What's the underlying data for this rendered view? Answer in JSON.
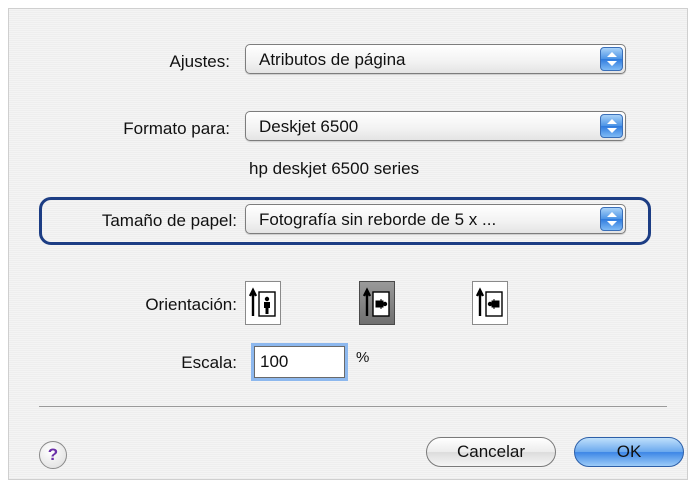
{
  "settings": {
    "label": "Ajustes:",
    "value": "Atributos de página"
  },
  "format_for": {
    "label": "Formato para:",
    "value": "Deskjet 6500",
    "subtitle": "hp deskjet 6500 series"
  },
  "paper_size": {
    "label": "Tamaño de papel:",
    "value": "Fotografía sin reborde de 5 x ..."
  },
  "orientation": {
    "label": "Orientación:",
    "options": [
      "portrait",
      "landscape",
      "reverse-landscape"
    ],
    "selected": "landscape"
  },
  "scale": {
    "label": "Escala:",
    "value": "100",
    "unit": "%"
  },
  "buttons": {
    "help": "?",
    "cancel": "Cancelar",
    "ok": "OK"
  },
  "colors": {
    "accent_blue": "#3d86e6",
    "highlight_ring": "#1c3d84",
    "help_purple": "#6b2fa8"
  }
}
